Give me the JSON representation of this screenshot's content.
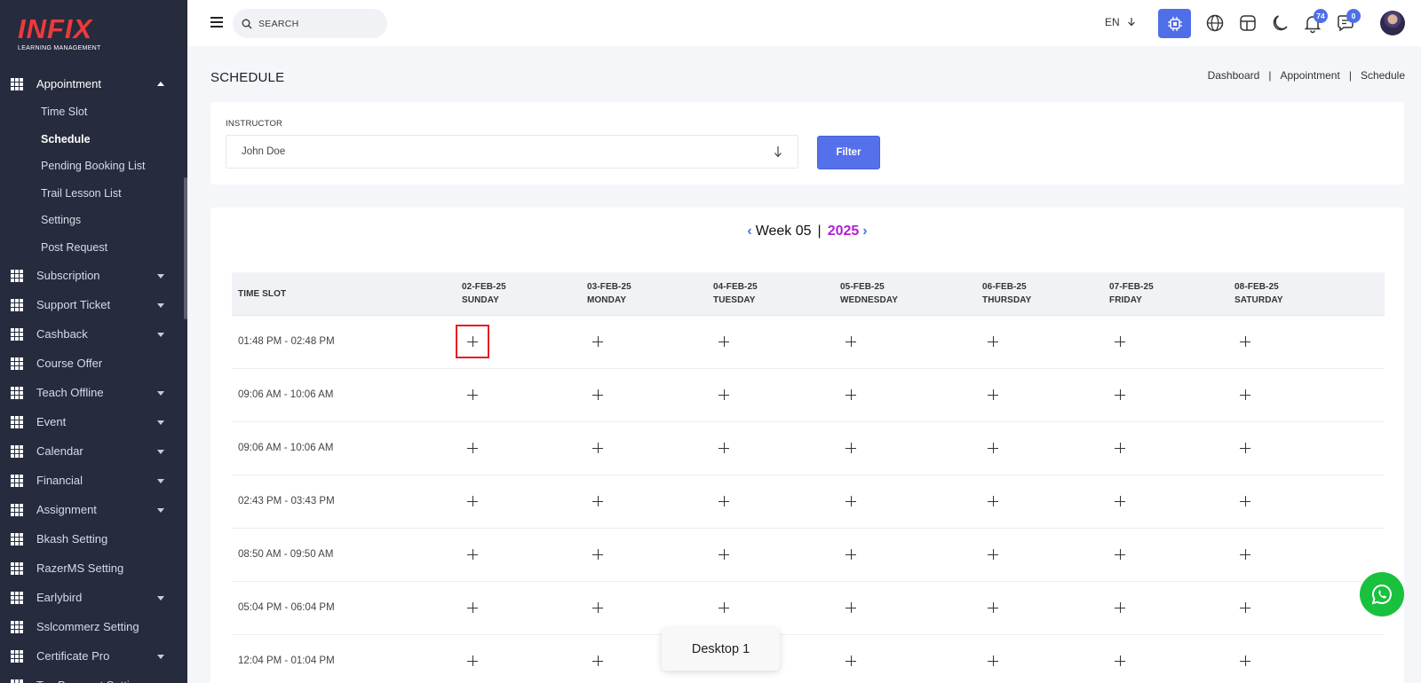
{
  "brand": {
    "logo_text": "INFIX",
    "logo_subtitle": "LEARNING MANAGEMENT"
  },
  "sidebar": {
    "items": [
      {
        "label": "Appointment",
        "expanded": true,
        "submenu": [
          {
            "label": "Time Slot"
          },
          {
            "label": "Schedule",
            "active": true
          },
          {
            "label": "Pending Booking List"
          },
          {
            "label": "Trail Lesson List"
          },
          {
            "label": "Settings"
          },
          {
            "label": "Post Request"
          }
        ]
      },
      {
        "label": "Subscription",
        "has_caret": true
      },
      {
        "label": "Support Ticket",
        "has_caret": true
      },
      {
        "label": "Cashback",
        "has_caret": true
      },
      {
        "label": "Course Offer",
        "has_caret": false
      },
      {
        "label": "Teach Offline",
        "has_caret": true
      },
      {
        "label": "Event",
        "has_caret": true
      },
      {
        "label": "Calendar",
        "has_caret": true
      },
      {
        "label": "Financial",
        "has_caret": true
      },
      {
        "label": "Assignment",
        "has_caret": true
      },
      {
        "label": "Bkash Setting",
        "has_caret": false
      },
      {
        "label": "RazerMS Setting",
        "has_caret": false
      },
      {
        "label": "Earlybird",
        "has_caret": true
      },
      {
        "label": "Sslcommerz Setting",
        "has_caret": false
      },
      {
        "label": "Certificate Pro",
        "has_caret": true
      },
      {
        "label": "Tax Payment Setting",
        "has_caret": false
      }
    ]
  },
  "topbar": {
    "search_placeholder": "SEARCH",
    "language": "EN",
    "notification_count": "74",
    "message_count": "0",
    "icons": [
      "menu-icon",
      "search-icon",
      "chip-icon",
      "globe-icon",
      "layout-icon",
      "moon-icon",
      "bell-icon",
      "chat-icon"
    ]
  },
  "page": {
    "title": "SCHEDULE",
    "breadcrumb": [
      "Dashboard",
      "Appointment",
      "Schedule"
    ],
    "breadcrumb_separator": "|"
  },
  "filter": {
    "label": "INSTRUCTOR",
    "selected": "John Doe",
    "button_label": "Filter"
  },
  "schedule": {
    "week_label": "Week 05",
    "separator": "|",
    "year": "2025",
    "time_slot_header": "TIME SLOT",
    "days": [
      {
        "date": "02-FEB-25",
        "day": "SUNDAY"
      },
      {
        "date": "03-FEB-25",
        "day": "MONDAY"
      },
      {
        "date": "04-FEB-25",
        "day": "TUESDAY"
      },
      {
        "date": "05-FEB-25",
        "day": "WEDNESDAY"
      },
      {
        "date": "06-FEB-25",
        "day": "THURSDAY"
      },
      {
        "date": "07-FEB-25",
        "day": "FRIDAY"
      },
      {
        "date": "08-FEB-25",
        "day": "SATURDAY"
      }
    ],
    "slots": [
      "01:48 PM - 02:48 PM",
      "09:06 AM - 10:06 AM",
      "09:06 AM - 10:06 AM",
      "02:43 PM - 03:43 PM",
      "08:50 AM - 09:50 AM",
      "05:04 PM - 06:04 PM",
      "12:04 PM - 01:04 PM"
    ]
  },
  "tooltip": "Desktop 1",
  "colors": {
    "sidebar": "#262b3d",
    "accent": "#4f6fe8",
    "year": "#b11fd6",
    "highlight": "#e31f1f",
    "whatsapp": "#19c13e"
  }
}
